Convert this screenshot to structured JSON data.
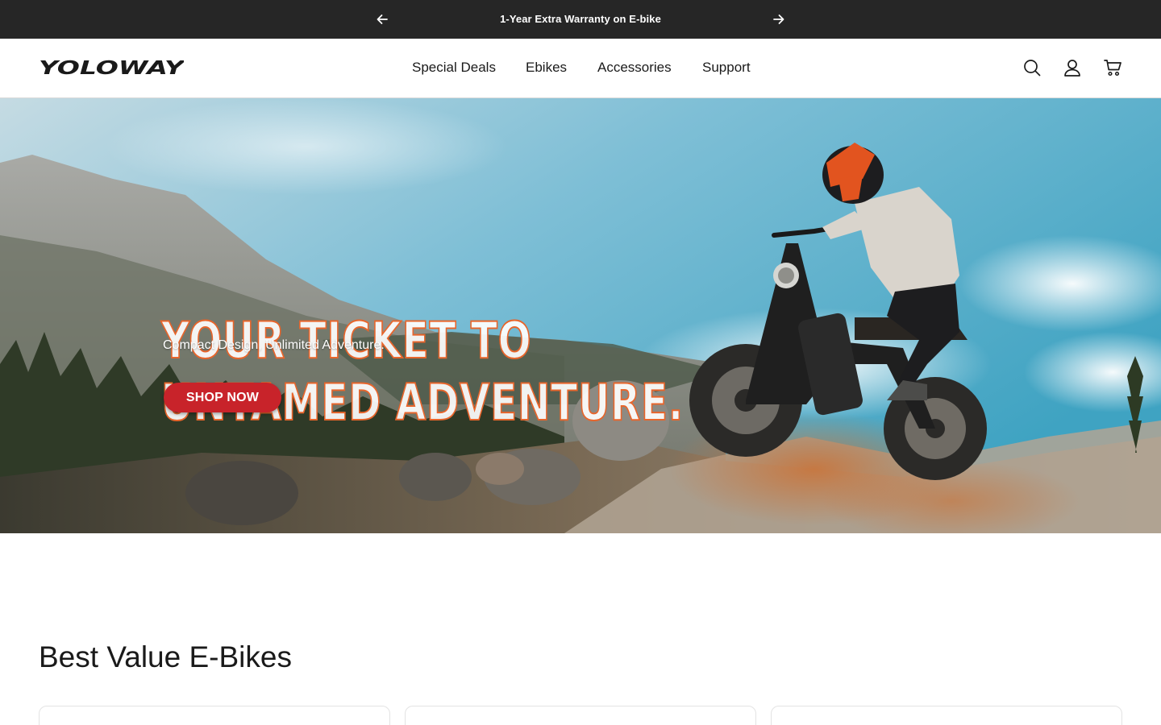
{
  "announcement": {
    "message": "1-Year Extra Warranty on E-bike",
    "prev_icon": "arrow-left-icon",
    "next_icon": "arrow-right-icon"
  },
  "header": {
    "logo_text": "YOLOWAY",
    "nav": [
      {
        "label": "Special Deals"
      },
      {
        "label": "Ebikes"
      },
      {
        "label": "Accessories"
      },
      {
        "label": "Support"
      }
    ],
    "icons": [
      "search-icon",
      "account-icon",
      "cart-icon"
    ]
  },
  "hero": {
    "title_line1": "YOUR TICKET TO",
    "title_line2": "UNTAMED ADVENTURE.",
    "subtitle": "Compact Design, Unlimited Adventure.",
    "cta_label": "SHOP NOW",
    "colors": {
      "title_outline": "#e8652b",
      "cta": "#c8232a"
    }
  },
  "section": {
    "title": "Best Value E-Bikes",
    "cards": [
      {},
      {},
      {}
    ]
  }
}
